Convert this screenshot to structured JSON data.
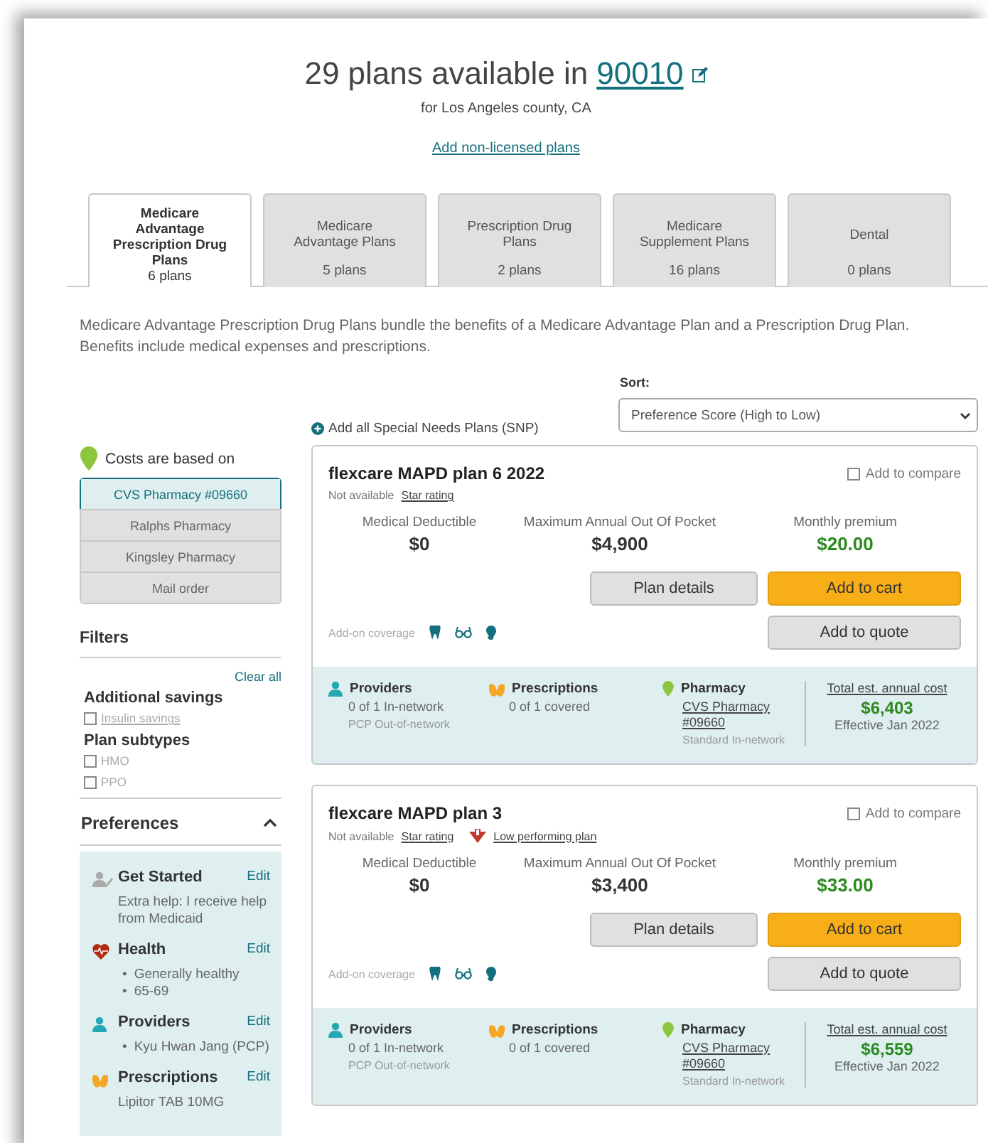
{
  "header": {
    "title": "29 plans available in",
    "zip": "90010",
    "county": "for Los Angeles county, CA",
    "nonlicensed_link": "Add non-licensed plans"
  },
  "tabs": [
    {
      "label": "Medicare Advantage Prescription Drug Plans",
      "count": "6 plans",
      "selected": true
    },
    {
      "label": "Medicare Advantage Plans",
      "count": "5 plans",
      "selected": false
    },
    {
      "label": "Prescription Drug Plans",
      "count": "2 plans",
      "selected": false
    },
    {
      "label": "Medicare Supplement Plans",
      "count": "16 plans",
      "selected": false
    },
    {
      "label": "Dental",
      "count": "0 plans",
      "selected": false
    }
  ],
  "description": "Medicare Advantage Prescription Drug Plans bundle the benefits of a Medicare Advantage Plan and a Prescription Drug Plan. Benefits include medical expenses and prescriptions.",
  "sort": {
    "label": "Sort:",
    "value": "Preference Score (High to Low)"
  },
  "snp_link": "Add all Special Needs Plans (SNP)",
  "pharmacy": {
    "heading": "Costs are based on",
    "options": [
      {
        "label": "CVS Pharmacy #09660",
        "selected": true
      },
      {
        "label": "Ralphs Pharmacy",
        "selected": false
      },
      {
        "label": "Kingsley Pharmacy",
        "selected": false
      },
      {
        "label": "Mail order",
        "selected": false
      }
    ]
  },
  "filters": {
    "title": "Filters",
    "clear_all": "Clear all",
    "groups": [
      {
        "title": "Additional savings",
        "options": [
          {
            "label": "Insulin savings",
            "kind": "link",
            "checked": false
          }
        ]
      },
      {
        "title": "Plan subtypes",
        "options": [
          {
            "label": "HMO",
            "kind": "plain",
            "checked": false
          },
          {
            "label": "PPO",
            "kind": "plain",
            "checked": false
          }
        ]
      }
    ]
  },
  "preferences": {
    "title": "Preferences",
    "expanded": true,
    "sections": [
      {
        "kind": "get_started",
        "title": "Get Started",
        "edit": "Edit",
        "text": "Extra help: I receive help from Medicaid"
      },
      {
        "kind": "health",
        "title": "Health",
        "edit": "Edit",
        "bullet": "•",
        "bullets": [
          "Generally healthy",
          "65-69"
        ]
      },
      {
        "kind": "providers",
        "title": "Providers",
        "edit": "Edit",
        "bullet": "•",
        "bullets": [
          "Kyu Hwan Jang (PCP)"
        ]
      },
      {
        "kind": "prescriptions",
        "title": "Prescriptions",
        "edit": "Edit",
        "text": "Lipitor TAB 10MG"
      }
    ]
  },
  "plans": [
    {
      "name": "flexcare MAPD plan 6 2022",
      "compare_label": "Add to compare",
      "compare_checked": false,
      "star_status": "Not available",
      "star_link": "Star rating",
      "stats": [
        {
          "label": "Medical Deductible",
          "value": "$0"
        },
        {
          "label": "Maximum Annual Out Of Pocket",
          "value": "$4,900"
        }
      ],
      "premium_label": "Monthly premium",
      "premium": "$20.00",
      "details_button": "Plan details",
      "cart_button": "Add to cart",
      "quote_button": "Add to quote",
      "addon_label": "Add-on coverage",
      "summary": {
        "providers_title": "Providers",
        "providers_line": "0 of 1 In-network",
        "providers_note": "PCP Out-of-network",
        "rx_title": "Prescriptions",
        "rx_line": "0 of 1 covered",
        "pharmacy_title": "Pharmacy",
        "pharmacy_link": "CVS Pharmacy #09660",
        "pharmacy_note": "Standard In-network",
        "total_label": "Total est. annual cost",
        "total": "$6,403",
        "effective": "Effective Jan 2022"
      }
    },
    {
      "name": "flexcare MAPD plan 3",
      "compare_label": "Add to compare",
      "compare_checked": false,
      "star_status": "Not available",
      "star_link": "Star rating",
      "low_performing": "Low performing plan",
      "stats": [
        {
          "label": "Medical Deductible",
          "value": "$0"
        },
        {
          "label": "Maximum Annual Out Of Pocket",
          "value": "$3,400"
        }
      ],
      "premium_label": "Monthly premium",
      "premium": "$33.00",
      "details_button": "Plan details",
      "cart_button": "Add to cart",
      "quote_button": "Add to quote",
      "addon_label": "Add-on coverage",
      "summary": {
        "providers_title": "Providers",
        "providers_line": "0 of 1 In-network",
        "providers_note": "PCP Out-of-network",
        "rx_title": "Prescriptions",
        "rx_line": "0 of 1 covered",
        "pharmacy_title": "Pharmacy",
        "pharmacy_link": "CVS Pharmacy #09660",
        "pharmacy_note": "Standard In-network",
        "total_label": "Total est. annual cost",
        "total": "$6,559",
        "effective": "Effective Jan 2022"
      }
    }
  ]
}
